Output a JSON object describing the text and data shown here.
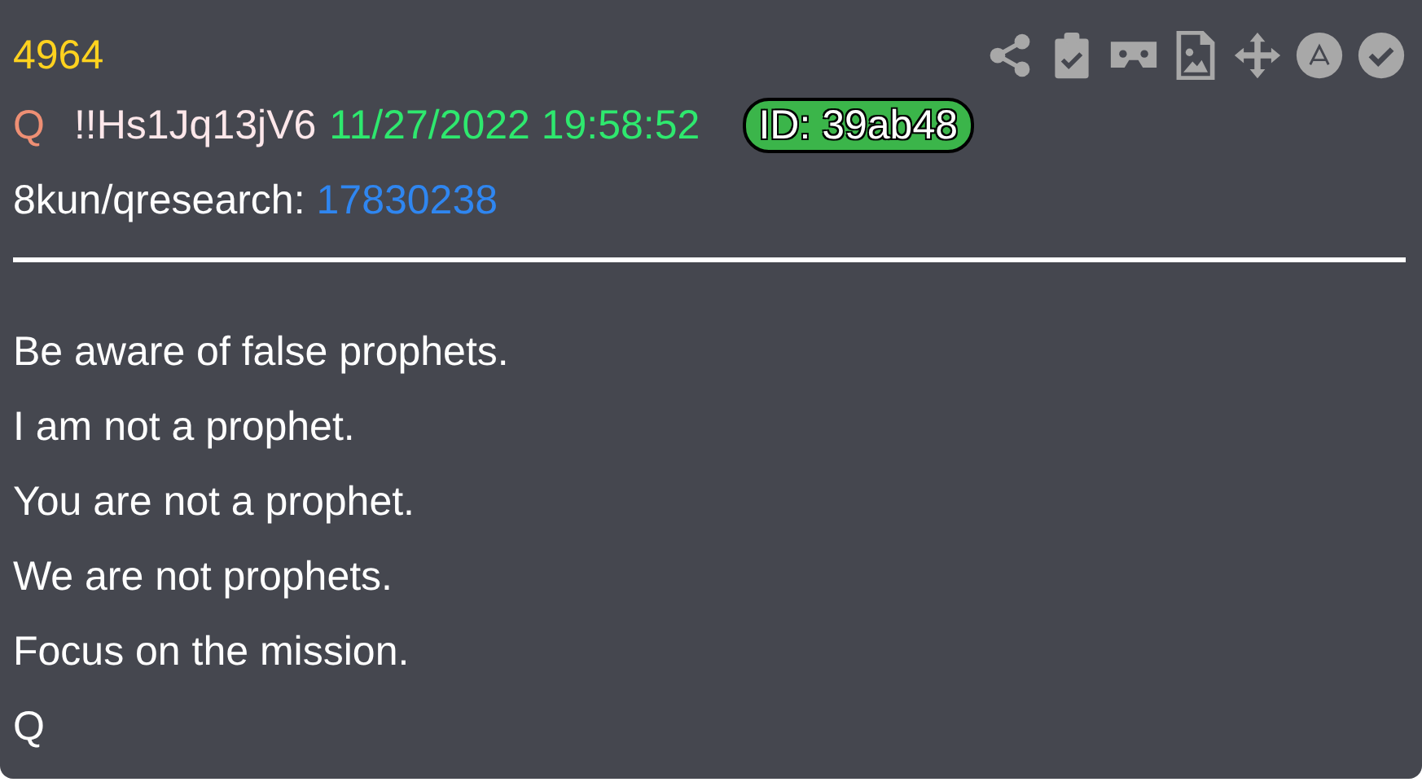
{
  "post": {
    "number": "4964",
    "author": "Q",
    "tripcode": "!!Hs1Jq13jV6",
    "timestamp": "11/27/2022 19:58:52",
    "id_badge": "ID: 39ab48",
    "board": "8kun/qresearch:",
    "post_link": "17830238",
    "body": [
      "Be aware of false prophets.",
      "I am not a prophet.",
      "You are not a prophet.",
      "We are not prophets.",
      "Focus on the mission.",
      "Q"
    ]
  }
}
